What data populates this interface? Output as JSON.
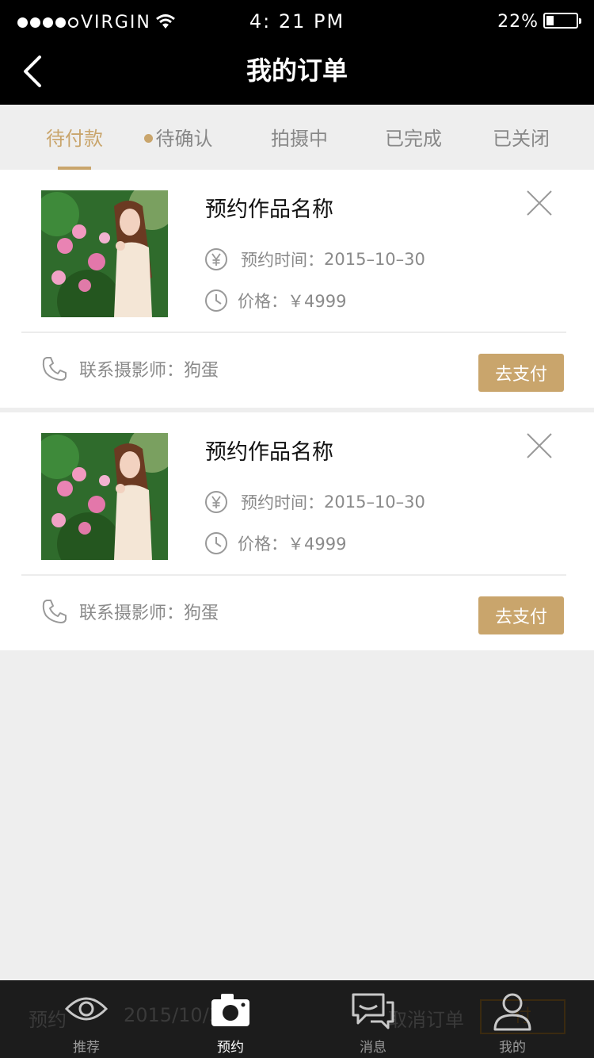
{
  "status_bar": {
    "carrier": "VIRGIN",
    "time": "4: 21 PM",
    "battery": "22%"
  },
  "header": {
    "title": "我的订单"
  },
  "tabs": [
    {
      "label": "待付款",
      "active": true,
      "badge": false
    },
    {
      "label": "待确认",
      "active": false,
      "badge": true
    },
    {
      "label": "拍摄中",
      "active": false,
      "badge": false
    },
    {
      "label": "已完成",
      "active": false,
      "badge": false
    },
    {
      "label": "已关闭",
      "active": false,
      "badge": false
    }
  ],
  "orders": [
    {
      "title": "预约作品名称",
      "time_label": "预约时间：",
      "time_value": "2015–10–30",
      "price_label": "价格：",
      "price_value": "￥4999",
      "contact_label": "联系摄影师：",
      "contact_name": "狗蛋",
      "action_label": "去支付"
    },
    {
      "title": "预约作品名称",
      "time_label": "预约时间：",
      "time_value": "2015–10–30",
      "price_label": "价格：",
      "price_value": "￥4999",
      "contact_label": "联系摄影师：",
      "contact_name": "狗蛋",
      "action_label": "去支付"
    }
  ],
  "bottom_ghost": {
    "left_text": "预约",
    "date_text": "2015/10/3",
    "cancel_text": "取消订单",
    "button_text": "付"
  },
  "bottom_nav": [
    {
      "label": "推荐",
      "icon": "eye-icon",
      "active": false
    },
    {
      "label": "预约",
      "icon": "camera-icon",
      "active": true
    },
    {
      "label": "消息",
      "icon": "chat-icon",
      "active": false
    },
    {
      "label": "我的",
      "icon": "user-icon",
      "active": false
    }
  ],
  "colors": {
    "accent": "#c9a56c",
    "header_bg": "#000000",
    "page_bg": "#eeeeee",
    "bottom_bar_bg": "#1c1c1c"
  }
}
